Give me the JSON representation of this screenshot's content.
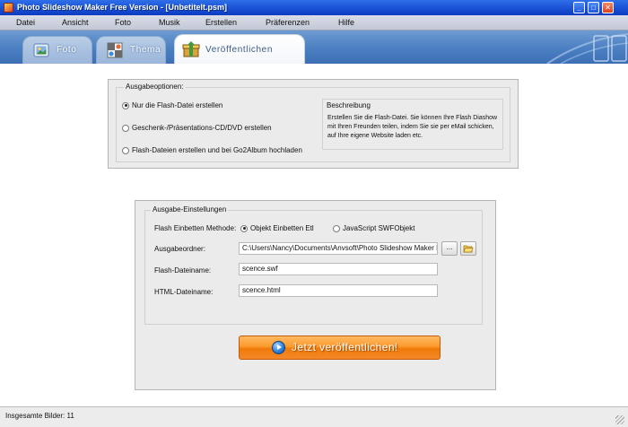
{
  "window": {
    "title": "Photo Slideshow Maker Free Version - [Unbetitelt.psm]",
    "minimize_glyph": "_",
    "maximize_glyph": "□",
    "close_glyph": "✕"
  },
  "menu": {
    "items": [
      "Datei",
      "Ansicht",
      "Foto",
      "Musik",
      "Erstellen",
      "Präferenzen",
      "Hilfe"
    ]
  },
  "tabs": {
    "items": [
      {
        "label": "Foto",
        "icon": "photo-icon"
      },
      {
        "label": "Thema",
        "icon": "theme-icon"
      },
      {
        "label": "Veröffentlichen",
        "icon": "publish-box-icon"
      }
    ],
    "active_index": 2
  },
  "output_options": {
    "group_title": "Ausgabeoptionen:",
    "options": [
      {
        "label": "Nur die Flash-Datei erstellen",
        "selected": true
      },
      {
        "label": "Geschenk-/Präsentations-CD/DVD erstellen",
        "selected": false
      },
      {
        "label": "Flash-Dateien erstellen und bei Go2Album hochladen",
        "selected": false
      }
    ],
    "description_title": "Beschreibung",
    "description_text": "Erstellen Sie die Flash-Datei. Sie können Ihre Flash Diashow mit Ihren Freunden teilen, indem Sie sie per eMail schicken, auf Ihre eigene Website laden etc."
  },
  "output_settings": {
    "group_title": "Ausgabe-Einstellungen",
    "embed_method_label": "Flash Einbetten Methode:",
    "embed_options": [
      {
        "label": "Objekt Einbetten Etl",
        "selected": true
      },
      {
        "label": "JavaScript SWFObjekt",
        "selected": false
      }
    ],
    "folder_label": "Ausgabeordner:",
    "folder_value": "C:\\Users\\Nancy\\Documents\\Anvsoft\\Photo Slideshow Maker Free",
    "browse_label": "...",
    "flash_filename_label": "Flash-Dateiname:",
    "flash_filename_value": "scence.swf",
    "html_filename_label": "HTML-Dateiname:",
    "html_filename_value": "scence.html"
  },
  "publish_button": {
    "label": "Jetzt veröffentlichen!",
    "icon": "play-circle-icon"
  },
  "status": {
    "text": "Insgesamte Bilder: 11"
  },
  "colors": {
    "titlebar": "#1d56d8",
    "tabstrip": "#4a7fc2",
    "publish_button": "#f78a1a",
    "panel": "#ebebeb"
  }
}
